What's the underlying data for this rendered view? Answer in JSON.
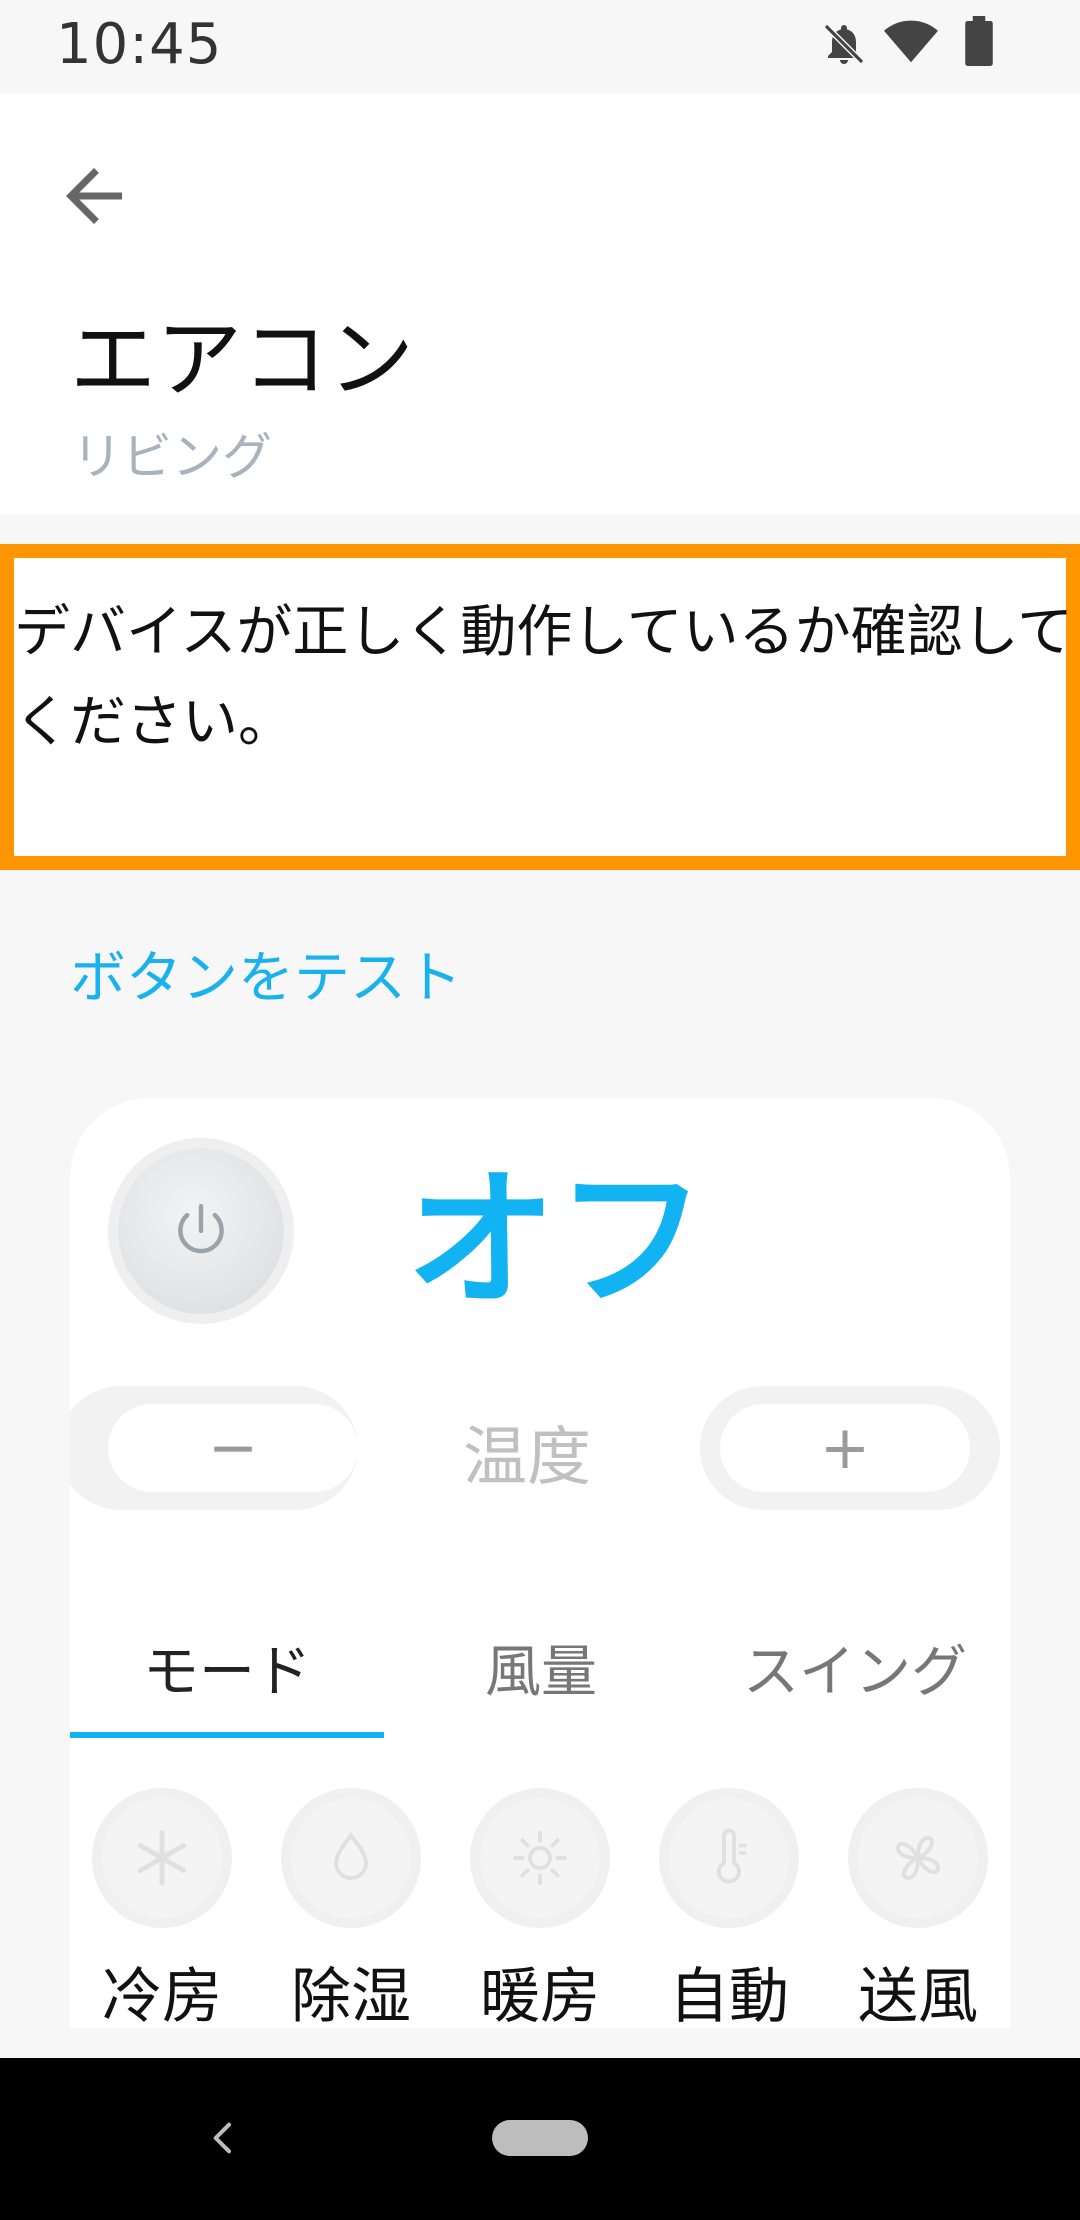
{
  "status_bar": {
    "time": "10:45"
  },
  "header": {
    "title": "エアコン",
    "subtitle": "リビング"
  },
  "banner": {
    "message": "デバイスが正しく動作しているか確認してください。"
  },
  "test_link": "ボタンをテスト",
  "remote": {
    "power_state": "オフ",
    "temp_label": "温度",
    "minus_label": "−",
    "plus_label": "+",
    "tabs": [
      {
        "label": "モード",
        "active": true
      },
      {
        "label": "風量",
        "active": false
      },
      {
        "label": "スイング",
        "active": false
      }
    ],
    "modes": [
      {
        "label": "冷房",
        "icon": "snowflake-icon"
      },
      {
        "label": "除湿",
        "icon": "droplet-icon"
      },
      {
        "label": "暖房",
        "icon": "sun-icon"
      },
      {
        "label": "自動",
        "icon": "thermometer-icon"
      },
      {
        "label": "送風",
        "icon": "fan-icon"
      }
    ]
  },
  "colors": {
    "accent": "#12b3f2",
    "highlight_border": "#ff9500"
  }
}
